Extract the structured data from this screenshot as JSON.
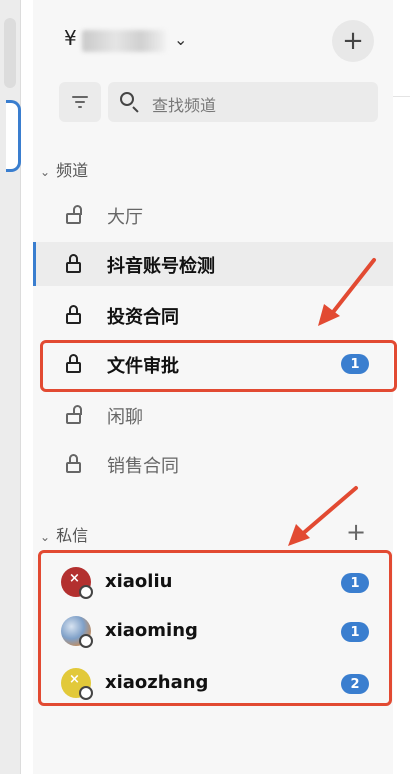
{
  "server": {
    "name_prefix": "¥",
    "chevron": "⌄",
    "add_button": "+"
  },
  "search": {
    "placeholder": "查找频道"
  },
  "channels_section": {
    "title": "频道",
    "items": [
      {
        "label": "大厅",
        "icon": "unlock-icon",
        "state": "muted",
        "badge": ""
      },
      {
        "label": "抖音账号检测",
        "icon": "lock-icon",
        "state": "active",
        "badge": ""
      },
      {
        "label": "投资合同",
        "icon": "lock-icon",
        "state": "bold",
        "badge": ""
      },
      {
        "label": "文件审批",
        "icon": "lock-icon",
        "state": "bold",
        "badge": "1"
      },
      {
        "label": "闲聊",
        "icon": "unlock-icon",
        "state": "muted",
        "badge": ""
      },
      {
        "label": "销售合同",
        "icon": "lock-icon",
        "state": "muted",
        "badge": ""
      }
    ]
  },
  "dm_section": {
    "title": "私信",
    "add_button": "+",
    "items": [
      {
        "name": "xiaoliu",
        "avatar_color": "#b3302f",
        "badge": "1"
      },
      {
        "name": "xiaoming",
        "avatar_color": "#7fa0c8",
        "badge": "1"
      },
      {
        "name": "xiaozhang",
        "avatar_color": "#e2c93a",
        "badge": "2"
      }
    ]
  },
  "colors": {
    "accent": "#3a7ecf",
    "annotation": "#e24a32"
  }
}
